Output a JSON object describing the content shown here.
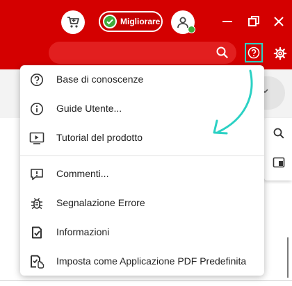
{
  "colors": {
    "brand_red": "#d40000",
    "highlight": "#2bd1c4",
    "ok_green": "#3faa3a"
  },
  "header": {
    "upgrade_label": "Migliorare",
    "search_placeholder": ""
  },
  "icons": {
    "cart": "cart-icon",
    "upgrade": "check-circle-icon",
    "avatar": "user-icon",
    "minimize": "minimize-icon",
    "restore": "restore-icon",
    "close": "close-icon",
    "search": "search-icon",
    "help": "help-icon",
    "settings": "gear-icon"
  },
  "menu": {
    "items": [
      {
        "label": "Base di conoscenze",
        "icon": "help-circle-icon"
      },
      {
        "label": "Guide Utente...",
        "icon": "info-icon"
      },
      {
        "label": "Tutorial del prodotto",
        "icon": "play-video-icon"
      },
      {
        "label": "Commenti...",
        "icon": "feedback-icon"
      },
      {
        "label": "Segnalazione Errore",
        "icon": "bug-icon"
      },
      {
        "label": "Informazioni",
        "icon": "about-icon"
      },
      {
        "label": "Imposta come Applicazione PDF Predefinita",
        "icon": "default-app-icon"
      }
    ]
  }
}
